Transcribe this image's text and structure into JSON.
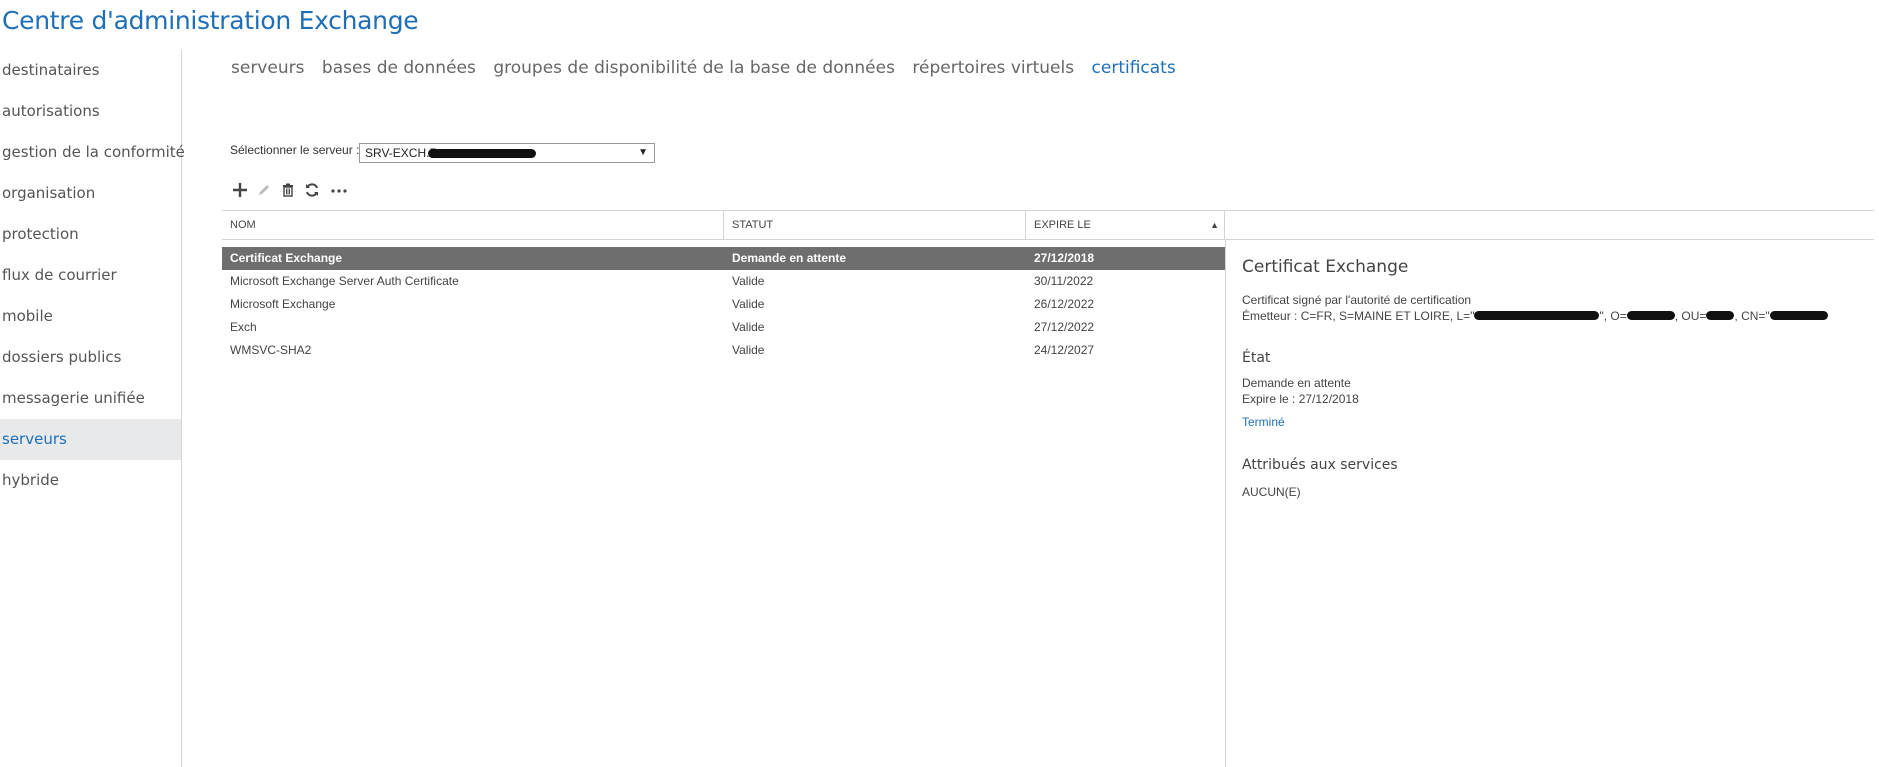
{
  "app_title": "Centre d'administration Exchange",
  "sidebar": {
    "items": [
      {
        "label": "destinataires"
      },
      {
        "label": "autorisations"
      },
      {
        "label": "gestion de la conformité"
      },
      {
        "label": "organisation"
      },
      {
        "label": "protection"
      },
      {
        "label": "flux de courrier"
      },
      {
        "label": "mobile"
      },
      {
        "label": "dossiers publics"
      },
      {
        "label": "messagerie unifiée"
      },
      {
        "label": "serveurs"
      },
      {
        "label": "hybride"
      }
    ],
    "active": "serveurs"
  },
  "tabs": [
    {
      "label": "serveurs"
    },
    {
      "label": "bases de données"
    },
    {
      "label": "groupes de disponibilité de la base de données"
    },
    {
      "label": "répertoires virtuels"
    },
    {
      "label": "certificats"
    }
  ],
  "active_tab": "certificats",
  "server_selector": {
    "label": "Sélectionner le serveur :",
    "value": "SRV-EXCH.R"
  },
  "toolbar": {
    "icons": [
      "add-icon",
      "edit-icon",
      "delete-icon",
      "refresh-icon",
      "more-icon"
    ]
  },
  "table": {
    "columns": [
      "NOM",
      "STATUT",
      "EXPIRE LE"
    ],
    "rows": [
      {
        "name": "Certificat Exchange",
        "status": "Demande en attente",
        "expires": "27/12/2018"
      },
      {
        "name": "Microsoft Exchange Server Auth Certificate",
        "status": "Valide",
        "expires": "30/11/2022"
      },
      {
        "name": "Microsoft Exchange",
        "status": "Valide",
        "expires": "26/12/2022"
      },
      {
        "name": "Exch",
        "status": "Valide",
        "expires": "27/12/2022"
      },
      {
        "name": "WMSVC-SHA2",
        "status": "Valide",
        "expires": "24/12/2027"
      }
    ]
  },
  "detail": {
    "title": "Certificat Exchange",
    "signed_by": "Certificat signé par l'autorité de certification",
    "issuer_prefix": "Émetteur : C=FR, S=MAINE ET LOIRE, L=\"",
    "issuer_o": "\", O=",
    "issuer_ou": ", OU=",
    "issuer_cn": ", CN=\"",
    "state_heading": "État",
    "state_value": "Demande en attente",
    "expires_label": "Expire le : 27/12/2018",
    "complete_link": "Terminé",
    "services_heading": "Attribués aux services",
    "services_value": "AUCUN(E)"
  },
  "colors": {
    "accent": "#1e6fb8",
    "selected_row": "#6e6e6e",
    "sidebar_active_bg": "#e8e9ea"
  }
}
